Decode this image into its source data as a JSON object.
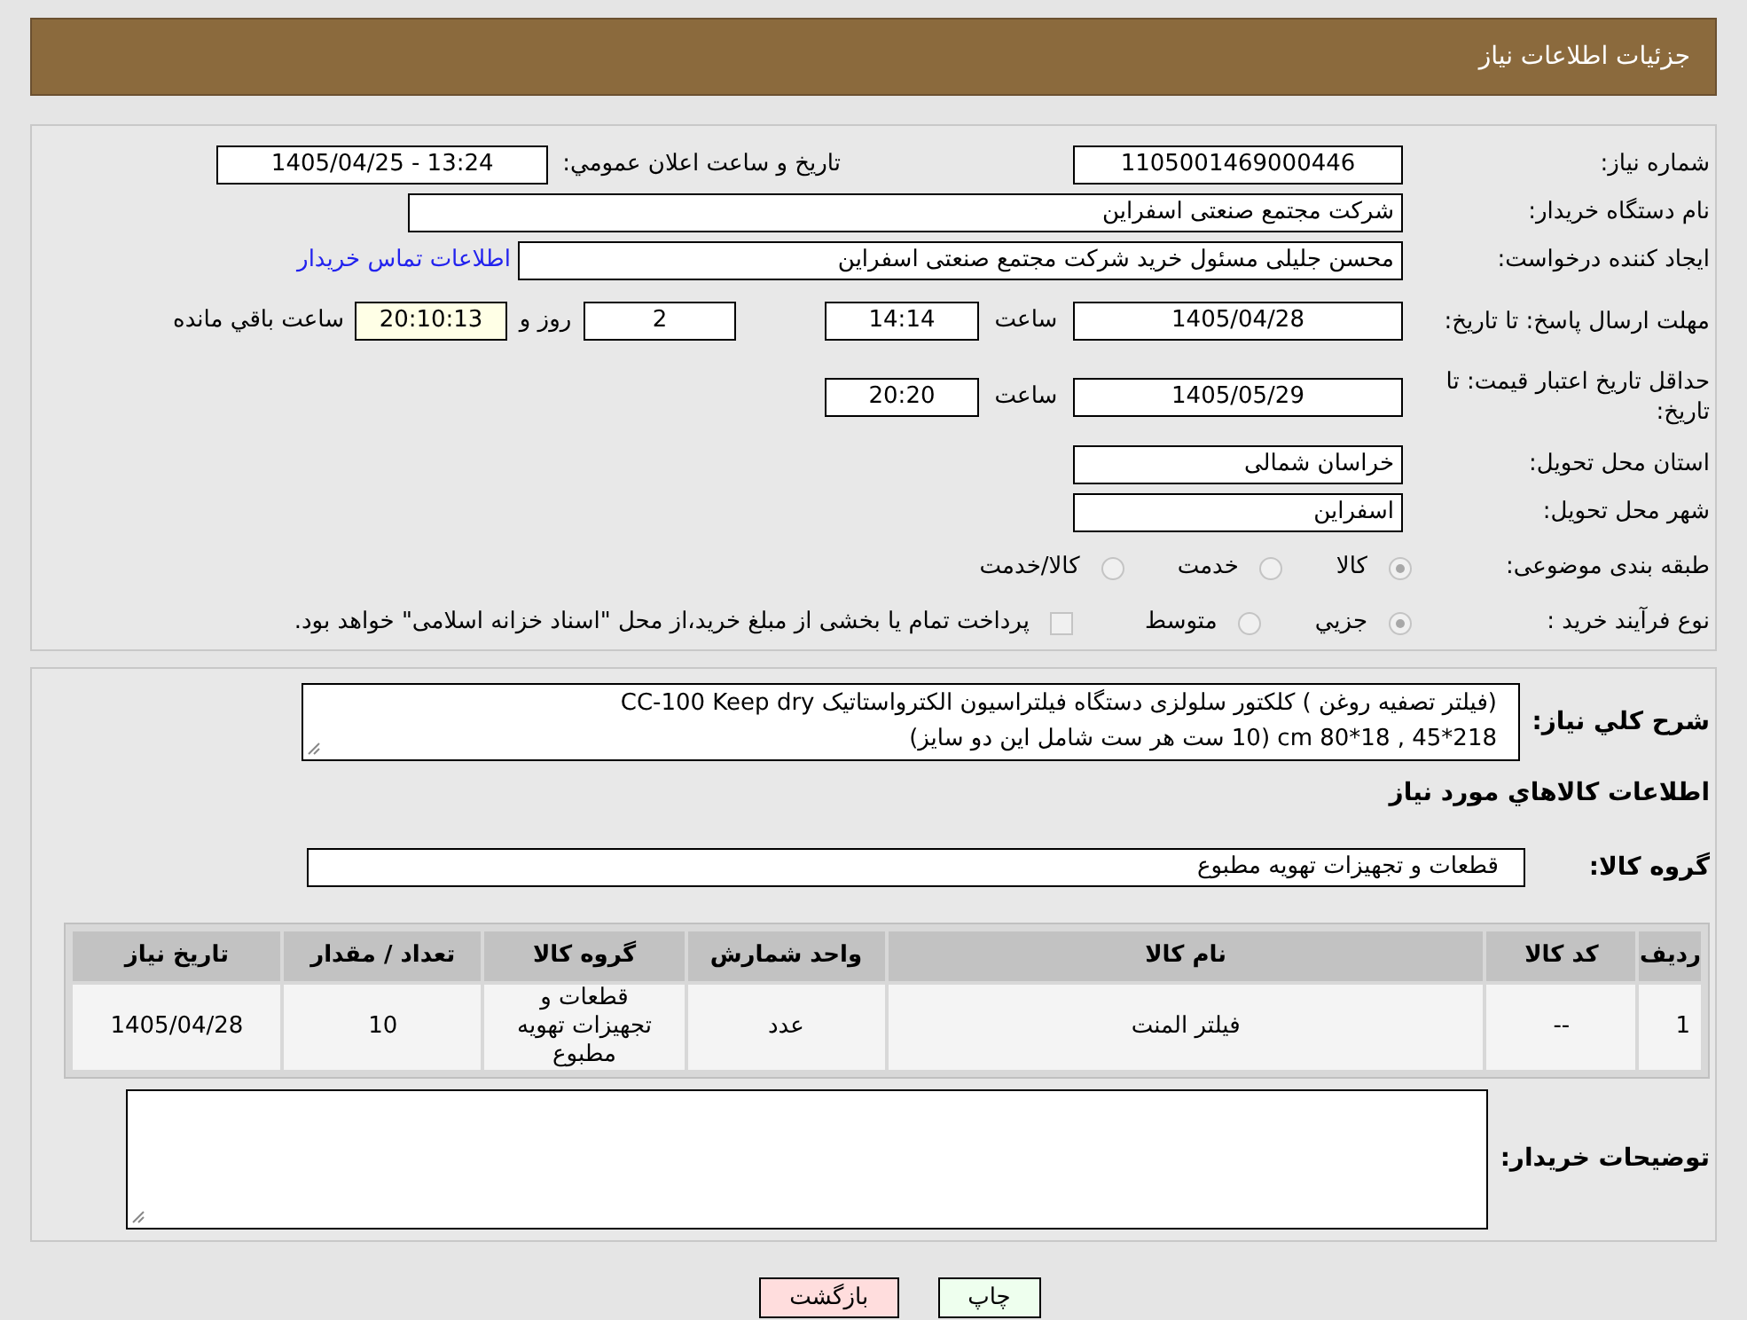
{
  "header": {
    "title": "جزئيات اطلاعات نياز"
  },
  "need_number": {
    "label": "شماره نياز:",
    "value": "1105001469000446"
  },
  "announce": {
    "label": "تاريخ و ساعت اعلان عمومي:",
    "value": "1405/04/25 - 13:24"
  },
  "buyer": {
    "label": "نام دستگاه خريدار:",
    "value": "شرکت مجتمع صنعتی اسفراین"
  },
  "creator": {
    "label": "ايجاد کننده درخواست:",
    "value": "محسن جلیلی مسئول خرید شرکت مجتمع صنعتی اسفراین",
    "link": "اطلاعات تماس خريدار"
  },
  "reply_deadline": {
    "label": "مهلت ارسال پاسخ: تا تاريخ:",
    "date": "1405/04/28",
    "time_label": "ساعت",
    "time": "14:14",
    "days": "2",
    "days_label": "روز و",
    "remaining": "20:10:13",
    "remaining_label": "ساعت باقي مانده"
  },
  "price_validity": {
    "label": "حداقل تاريخ اعتبار قيمت: تا تاريخ:",
    "date": "1405/05/29",
    "time_label": "ساعت",
    "time": "20:20"
  },
  "province": {
    "label": "استان محل تحويل:",
    "value": "خراسان شمالی"
  },
  "city": {
    "label": "شهر محل تحويل:",
    "value": "اسفراین"
  },
  "category": {
    "label": "طبقه بندی موضوعی:",
    "options": [
      {
        "label": "کالا",
        "selected": true
      },
      {
        "label": "خدمت",
        "selected": false
      },
      {
        "label": "کالا/خدمت",
        "selected": false
      }
    ]
  },
  "process": {
    "label": "نوع فرآيند خريد :",
    "options": [
      {
        "label": "جزيي",
        "selected": true
      },
      {
        "label": "متوسط",
        "selected": false
      }
    ],
    "payment": {
      "label": "پرداخت تمام يا بخشی از مبلغ خريد،از محل \"اسناد خزانه اسلامی\" خواهد بود.",
      "checked": false
    }
  },
  "description": {
    "label": "شرح کلي نياز:",
    "lines": [
      "(فیلتر تصفیه روغن ) کلکتور سلولزی دستگاه فیلتراسیون الکترواستاتیک CC-100 Keep dry",
      "218*45 , 18*80 cm (10 ست هر ست شامل این دو سایز)"
    ]
  },
  "goods_title": "اطلاعات کالاهاي مورد نياز",
  "group": {
    "label": "گروه کالا:",
    "value": "قطعات و تجهیزات تهویه مطبوع"
  },
  "table": {
    "columns": [
      "رديف",
      "کد کالا",
      "نام کالا",
      "واحد شمارش",
      "گروه کالا",
      "تعداد / مقدار",
      "تاريخ نياز"
    ],
    "rows": [
      [
        "1",
        "--",
        "فیلتر المنت",
        "عدد",
        "قطعات و تجهیزات تهویه مطبوع",
        "10",
        "1405/04/28"
      ]
    ]
  },
  "buyer_notes": {
    "label": "توضيحات خريدار:"
  },
  "buttons": [
    {
      "label": "چاپ",
      "kind": "print"
    },
    {
      "label": "بازگشت",
      "kind": "back"
    }
  ]
}
